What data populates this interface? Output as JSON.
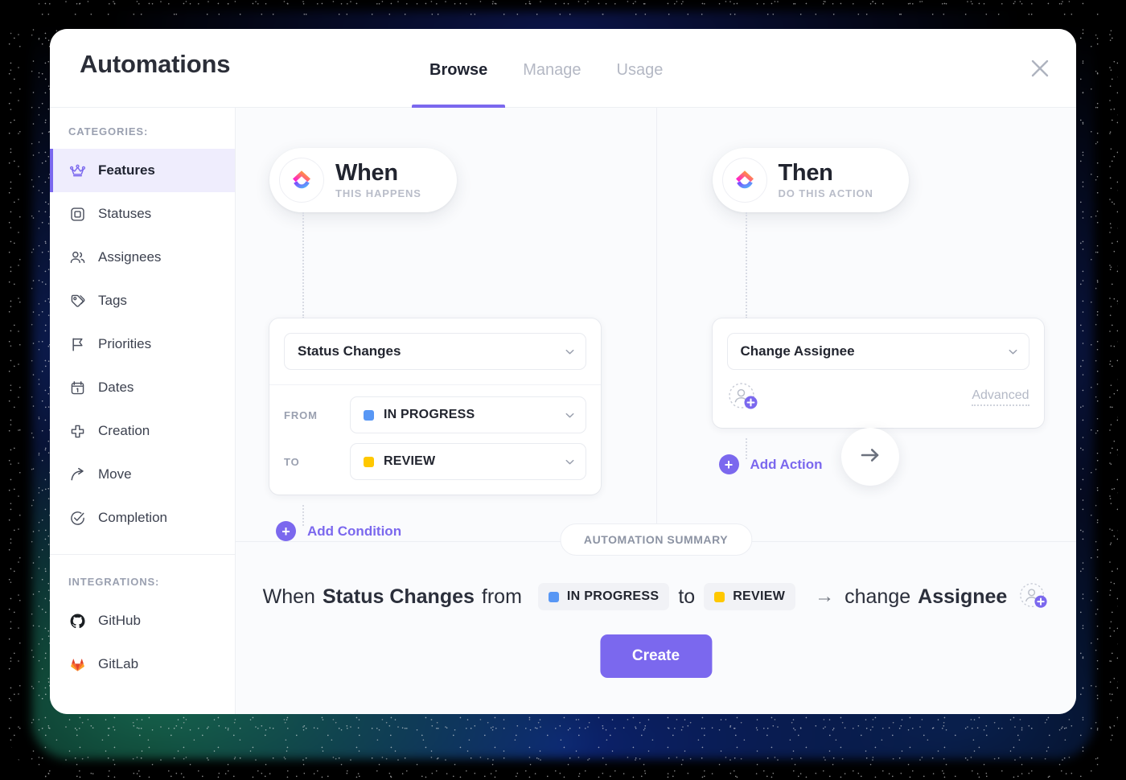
{
  "header": {
    "title": "Automations",
    "tabs": [
      {
        "label": "Browse",
        "active": true
      },
      {
        "label": "Manage",
        "active": false
      },
      {
        "label": "Usage",
        "active": false
      }
    ],
    "close_label": "close-icon"
  },
  "sidebar": {
    "categories_label": "CATEGORIES:",
    "items": [
      {
        "label": "Features",
        "icon": "crown-icon"
      },
      {
        "label": "Statuses",
        "icon": "square-outline-icon"
      },
      {
        "label": "Assignees",
        "icon": "people-icon"
      },
      {
        "label": "Tags",
        "icon": "tag-icon"
      },
      {
        "label": "Priorities",
        "icon": "flag-icon"
      },
      {
        "label": "Dates",
        "icon": "calendar-icon"
      },
      {
        "label": "Creation",
        "icon": "plus-thick-icon"
      },
      {
        "label": "Move",
        "icon": "arrow-curve-icon"
      },
      {
        "label": "Completion",
        "icon": "check-circle-icon"
      }
    ],
    "integrations_label": "INTEGRATIONS:",
    "integrations": [
      {
        "label": "GitHub",
        "icon": "github-icon"
      },
      {
        "label": "GitLab",
        "icon": "gitlab-icon"
      }
    ]
  },
  "when": {
    "heading": "When",
    "subheading": "THIS HAPPENS",
    "trigger": "Status Changes",
    "conditions": [
      {
        "label": "FROM",
        "value": "IN PROGRESS",
        "color": "#5897f5"
      },
      {
        "label": "TO",
        "value": "REVIEW",
        "color": "#ffc800"
      }
    ],
    "add_condition": "Add Condition"
  },
  "then": {
    "heading": "Then",
    "subheading": "DO THIS ACTION",
    "action": "Change Assignee",
    "advanced": "Advanced",
    "add_action": "Add Action"
  },
  "connector": {
    "icon": "arrow-right-icon"
  },
  "summary": {
    "pill": "AUTOMATION SUMMARY",
    "prefix": "When",
    "trigger": "Status Changes",
    "from_word": "from",
    "from_status": "IN PROGRESS",
    "from_color": "#5897f5",
    "to_word": "to",
    "to_status": "REVIEW",
    "to_color": "#ffc800",
    "arrow": "→",
    "action_word": "change",
    "action_target": "Assignee"
  },
  "create_button": "Create",
  "colors": {
    "accent": "#7b68ee",
    "active_nav_bg": "#efedfd",
    "main_bg": "#fafbfd",
    "status_blue": "#5897f5",
    "status_yellow": "#ffc800"
  }
}
